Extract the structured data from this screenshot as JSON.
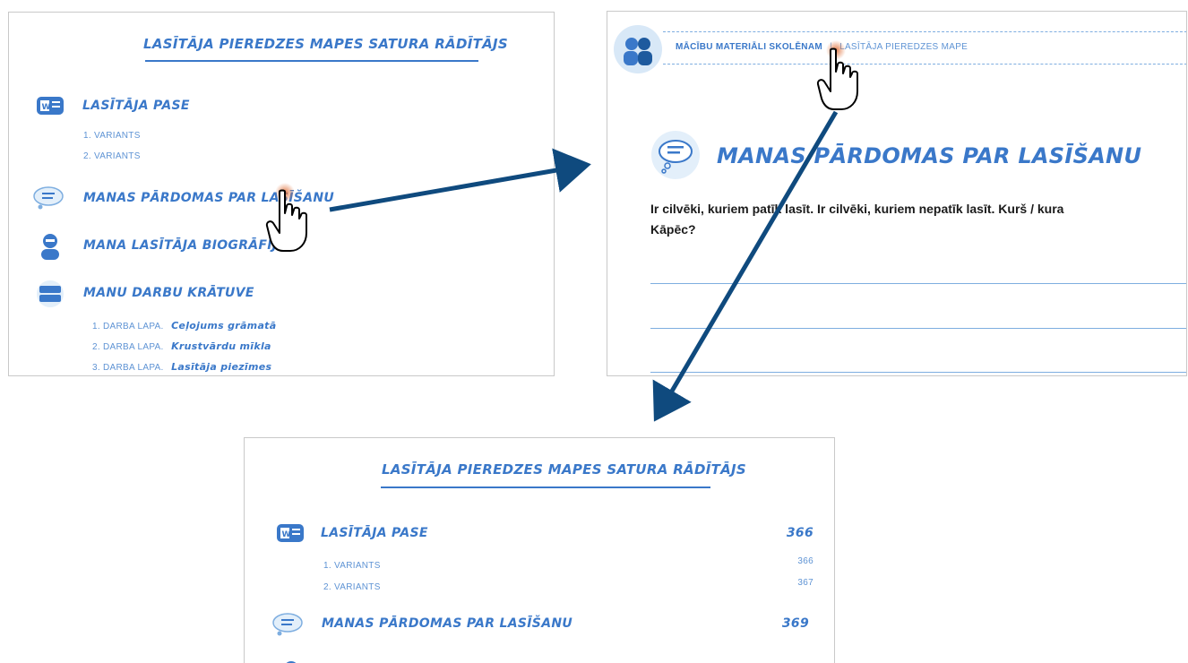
{
  "panel_toc_top": {
    "title": "LASĪTĀJA PIEREDZES MAPES SATURA RĀDĪTĀJS",
    "items": [
      {
        "label": "LASĪTĀJA PASE",
        "icon": "passport-icon",
        "subs": [
          "1. VARIANTS",
          "2. VARIANTS"
        ]
      },
      {
        "label": "MANAS PĀRDOMAS PAR LASĪŠANU",
        "icon": "thought-bubble-icon",
        "subs": []
      },
      {
        "label": "MANA LASĪTĀJA BIOGRĀFIJA",
        "icon": "person-icon",
        "subs": []
      },
      {
        "label": "MANU DARBU KRĀTUVE",
        "icon": "stack-icon",
        "subs": [
          {
            "prefix": "1. DARBA LAPA.",
            "title": "Ceļojums grāmatā"
          },
          {
            "prefix": "2. DARBA LAPA.",
            "title": "Krustvārdu mīkla"
          },
          {
            "prefix": "3. DARBA LAPA.",
            "title": "Lasītāja piezīmes"
          }
        ]
      }
    ]
  },
  "panel_page": {
    "breadcrumb": {
      "main": "MĀCĪBU MATERIĀLI SKOLĒNAM",
      "separator": "|",
      "current": "LASĪTĀJA PIEREDZES MAPE"
    },
    "heading": "MANAS PĀRDOMAS PAR LASĪŠANU",
    "question_line1": "Ir cilvēki, kuriem patīk lasīt. Ir cilvēki, kuriem nepatīk lasīt. Kurš / kura",
    "question_line2": "Kāpēc?"
  },
  "panel_toc_bottom": {
    "title": "LASĪTĀJA PIEREDZES MAPES SATURA RĀDĪTĀJS",
    "items": [
      {
        "label": "LASĪTĀJA PASE",
        "page": "366",
        "subs": [
          {
            "label": "1. VARIANTS",
            "page": "366"
          },
          {
            "label": "2. VARIANTS",
            "page": "367"
          }
        ]
      },
      {
        "label": "MANAS PĀRDOMAS PAR LASĪŠANU",
        "page": "369",
        "subs": []
      }
    ]
  },
  "colors": {
    "accent": "#3a78c9",
    "arrow": "#0f4a7e",
    "cursor_glow": "#e0703a"
  }
}
